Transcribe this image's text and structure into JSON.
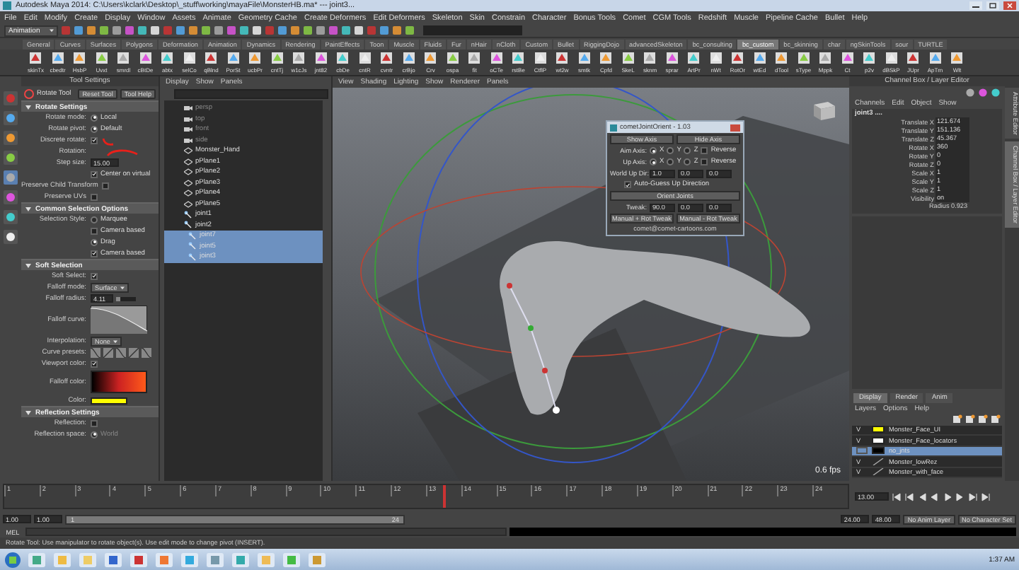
{
  "window": {
    "title": "Autodesk Maya 2014: C:\\Users\\kclark\\Desktop\\_stuff\\working\\mayaFile\\MonsterHB.ma* --- joint3..."
  },
  "menu_bar": [
    "File",
    "Edit",
    "Modify",
    "Create",
    "Display",
    "Window",
    "Assets",
    "Animate",
    "Geometry Cache",
    "Create Deformers",
    "Edit Deformers",
    "Skeleton",
    "Skin",
    "Constrain",
    "Character",
    "Bonus Tools",
    "Comet",
    "CGM Tools",
    "Redshift",
    "Muscle",
    "Pipeline Cache",
    "Bullet",
    "Help"
  ],
  "status_line": {
    "mode": "Animation"
  },
  "shelf": {
    "tabs": [
      {
        "label": "General",
        "selected": false
      },
      {
        "label": "Curves",
        "selected": false
      },
      {
        "label": "Surfaces",
        "selected": false
      },
      {
        "label": "Polygons",
        "selected": false
      },
      {
        "label": "Deformation",
        "selected": false
      },
      {
        "label": "Animation",
        "selected": false
      },
      {
        "label": "Dynamics",
        "selected": false
      },
      {
        "label": "Rendering",
        "selected": false
      },
      {
        "label": "PaintEffects",
        "selected": false
      },
      {
        "label": "Toon",
        "selected": false
      },
      {
        "label": "Muscle",
        "selected": false
      },
      {
        "label": "Fluids",
        "selected": false
      },
      {
        "label": "Fur",
        "selected": false
      },
      {
        "label": "nHair",
        "selected": false
      },
      {
        "label": "nCloth",
        "selected": false
      },
      {
        "label": "Custom",
        "selected": false
      },
      {
        "label": "Bullet",
        "selected": false
      },
      {
        "label": "RiggingDojo",
        "selected": false
      },
      {
        "label": "advancedSkeleton",
        "selected": false
      },
      {
        "label": "bc_consulting",
        "selected": false
      },
      {
        "label": "bc_custom",
        "selected": true
      },
      {
        "label": "bc_skinning",
        "selected": false
      },
      {
        "label": "char",
        "selected": false
      },
      {
        "label": "ngSkinTools",
        "selected": false
      },
      {
        "label": "sour",
        "selected": false
      },
      {
        "label": "TURTLE",
        "selected": false
      }
    ],
    "buttons": [
      "skinTx",
      "cbedtr",
      "HsbP",
      "Uvxt",
      "smrdl",
      "cBtDe",
      "abtx",
      "selCo",
      "qBlnd",
      "PorSt",
      "ucbPr",
      "cntTj",
      "w1cJs",
      "jnt82",
      "cbDe",
      "cntR",
      "cvntr",
      "crBjo",
      "Crv",
      "ospa",
      "fit",
      "oCTe",
      "rstBe",
      "CtflP",
      "wt2w",
      "smtk",
      "Cpfd",
      "SkeL",
      "sknm",
      "sprar",
      "ArtPr",
      "nWt",
      "RotOr",
      "wtEd",
      "dTool",
      "sType",
      "Mppk",
      "Ct",
      "p2v",
      "dBSkP",
      "JUpr",
      "ApTrn",
      "Wlt"
    ]
  },
  "tool_settings": {
    "header": "Tool Settings",
    "tool": "Rotate Tool",
    "buttons": [
      "Reset Tool",
      "Tool Help"
    ],
    "sections": [
      {
        "title": "Rotate Settings",
        "rows": [
          {
            "label": "Rotate mode:",
            "kind": "radio",
            "option": "Local",
            "selected": true
          },
          {
            "label": "Rotate pivot:",
            "kind": "radio",
            "option": "Default",
            "selected": true
          },
          {
            "label": "Discrete rotate:",
            "kind": "check",
            "checked": true
          },
          {
            "label": "Rotation:",
            "kind": "label"
          },
          {
            "label": "Step size:",
            "kind": "field",
            "value": "15.00"
          },
          {
            "kind": "check",
            "option": "Center on virtual",
            "checked": true
          },
          {
            "label": "Preserve Child Transform",
            "kind": "check",
            "checked": false
          },
          {
            "label": "Preserve UVs",
            "kind": "check",
            "checked": false
          }
        ]
      },
      {
        "title": "Common Selection Options",
        "rows": [
          {
            "label": "Selection Style:",
            "kind": "radio",
            "option": "Marquee",
            "selected": false
          },
          {
            "kind": "check",
            "option": "Camera based",
            "checked": false
          },
          {
            "kind": "radio",
            "option": "Drag",
            "selected": true
          },
          {
            "kind": "check",
            "option": "Camera based",
            "checked": true
          }
        ]
      },
      {
        "title": "Soft Selection",
        "rows": [
          {
            "label": "Soft Select:",
            "kind": "check",
            "checked": true
          },
          {
            "label": "Falloff mode:",
            "kind": "dropdown",
            "value": "Surface"
          },
          {
            "label": "Falloff radius:",
            "kind": "slider",
            "value": "4.11",
            "level": 0.2
          },
          {
            "label": "Falloff curve:",
            "kind": "curve"
          },
          {
            "label": "Interpolation:",
            "kind": "dropdown",
            "value": "None"
          },
          {
            "label": "Curve presets:",
            "kind": "presets"
          },
          {
            "label": "Viewport color:",
            "kind": "check",
            "checked": true
          },
          {
            "label": "Falloff color:",
            "kind": "gradient"
          },
          {
            "label": "Color:",
            "kind": "swatch",
            "color": "#ffff00"
          }
        ]
      },
      {
        "title": "Reflection Settings",
        "rows": [
          {
            "label": "Reflection:",
            "kind": "check",
            "checked": false
          },
          {
            "label": "Reflection space:",
            "kind": "radio",
            "option": "World",
            "selected": true,
            "disabled": true
          }
        ]
      }
    ]
  },
  "outliner": {
    "menu": [
      "Display",
      "Show",
      "Panels"
    ],
    "items": [
      {
        "label": "persp",
        "kind": "camera",
        "dimmed": true,
        "selected": false
      },
      {
        "label": "top",
        "kind": "camera",
        "dimmed": true,
        "selected": false
      },
      {
        "label": "front",
        "kind": "camera",
        "dimmed": true,
        "selected": false
      },
      {
        "label": "side",
        "kind": "camera",
        "dimmed": true,
        "selected": false
      },
      {
        "label": "Monster_Hand",
        "kind": "mesh",
        "dimmed": false,
        "selected": false
      },
      {
        "label": "pPlane1",
        "kind": "mesh",
        "dimmed": false,
        "selected": false
      },
      {
        "label": "pPlane2",
        "kind": "mesh",
        "dimmed": false,
        "selected": false
      },
      {
        "label": "pPlane3",
        "kind": "mesh",
        "dimmed": false,
        "selected": false
      },
      {
        "label": "pPlane4",
        "kind": "mesh",
        "dimmed": false,
        "selected": false
      },
      {
        "label": "pPlane5",
        "kind": "mesh",
        "dimmed": false,
        "selected": false
      },
      {
        "label": "joint1",
        "kind": "joint",
        "dimmed": false,
        "selected": false
      },
      {
        "label": "joint2",
        "kind": "joint",
        "dimmed": false,
        "selected": false,
        "children": [
          {
            "label": "joint7",
            "kind": "joint",
            "dimmed": false,
            "selected": true
          },
          {
            "label": "joint5",
            "kind": "joint",
            "dimmed": false,
            "selected": true
          },
          {
            "label": "joint3",
            "kind": "joint",
            "dimmed": false,
            "selected": true
          }
        ]
      }
    ]
  },
  "viewport": {
    "menu": [
      "View",
      "Shading",
      "Lighting",
      "Show",
      "Renderer",
      "Panels"
    ],
    "fps": "0.6 fps"
  },
  "joint_orient_dialog": {
    "title": "cometJointOrient - 1.03",
    "top_buttons": [
      "Show Axis",
      "Hide Axis"
    ],
    "axis_rows": [
      {
        "label": "Aim Axis:",
        "options": [
          {
            "label": "X",
            "selected": true
          },
          {
            "label": "Y",
            "selected": false
          },
          {
            "label": "Z",
            "selected": false
          }
        ],
        "reverse": {
          "label": "Reverse",
          "checked": false
        }
      },
      {
        "label": "Up Axis:",
        "options": [
          {
            "label": "X",
            "selected": true
          },
          {
            "label": "Y",
            "selected": false
          },
          {
            "label": "Z",
            "selected": false
          }
        ],
        "reverse": {
          "label": "Reverse",
          "checked": false
        }
      }
    ],
    "world_up": {
      "label": "World Up Dir:",
      "values": [
        "1.0",
        "0.0",
        "0.0"
      ]
    },
    "auto_guess": {
      "label": "Auto-Guess Up Direction",
      "checked": true
    },
    "orient_button": "Orient Joints",
    "tweak": {
      "label": "Tweak:",
      "values": [
        "90.0",
        "0.0",
        "0.0"
      ]
    },
    "tweak_buttons": [
      "Manual + Rot Tweak",
      "Manual - Rot Tweak"
    ],
    "footer": "comet@comet-cartoons.com"
  },
  "channel_box": {
    "header": "Channel Box / Layer Editor",
    "menu": [
      "Channels",
      "Edit",
      "Object",
      "Show"
    ],
    "node": "joint3 ....",
    "attributes": [
      {
        "label": "Translate X",
        "value": "121.674"
      },
      {
        "label": "Translate Y",
        "value": "151.136"
      },
      {
        "label": "Translate Z",
        "value": "45.367"
      },
      {
        "label": "Rotate X",
        "value": "360"
      },
      {
        "label": "Rotate Y",
        "value": "0"
      },
      {
        "label": "Rotate Z",
        "value": "0"
      },
      {
        "label": "Scale X",
        "value": "1"
      },
      {
        "label": "Scale Y",
        "value": "1"
      },
      {
        "label": "Scale Z",
        "value": "1"
      },
      {
        "label": "Visibility",
        "value": "on"
      }
    ],
    "shape_attribute": "Radius 0.923"
  },
  "side_tabs": [
    {
      "label": "Attribute Editor",
      "selected": false
    },
    {
      "label": "Channel Box / Layer Editor",
      "selected": true
    }
  ],
  "layer_editor": {
    "tabs": [
      {
        "label": "Display",
        "selected": true
      },
      {
        "label": "Render",
        "selected": false
      },
      {
        "label": "Anim",
        "selected": false
      }
    ],
    "menu": [
      "Layers",
      "Options",
      "Help"
    ],
    "layers": [
      {
        "label": "Monster_Face_UI",
        "visibility": "V",
        "selected": false,
        "color": "#ffff00"
      },
      {
        "label": "Monster_Face_locators",
        "visibility": "V",
        "selected": false,
        "color": "#ffffff"
      },
      {
        "label": "no_jnts",
        "selected": true,
        "color": "#000000"
      },
      {
        "label": "Monster_lowRez",
        "visibility": "V",
        "selected": false
      },
      {
        "label": "Monster_with_face",
        "visibility": "V",
        "selected": false
      }
    ]
  },
  "time_slider": {
    "ticks": [
      "1",
      "2",
      "3",
      "4",
      "5",
      "6",
      "7",
      "8",
      "9",
      "10",
      "11",
      "12",
      "13",
      "14",
      "15",
      "16",
      "17",
      "18",
      "19",
      "20",
      "21",
      "22",
      "23",
      "24"
    ],
    "current_frame": "13.00",
    "level": 0.52
  },
  "range_slider": {
    "start": "1.00",
    "playback_start": "1.00",
    "bar_start": "1",
    "bar_end": "24",
    "level": 1,
    "playback_end": "24.00",
    "end": "48.00",
    "anim_layer": "No Anim Layer",
    "character_set": "No Character Set"
  },
  "command_line": {
    "label": "MEL"
  },
  "help_line": "Rotate Tool: Use manipulator to rotate object(s). Use edit mode to change pivot (INSERT).",
  "taskbar": {
    "clock": "1:37 AM"
  }
}
